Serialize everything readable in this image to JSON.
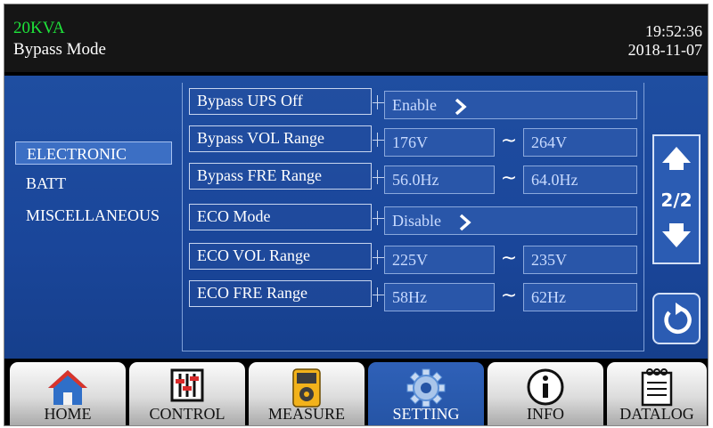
{
  "header": {
    "model": "20KVA",
    "mode": "Bypass Mode",
    "time": "19:52:36",
    "date": "2018-11-07"
  },
  "categories": [
    "ELECTRONIC",
    "BATT",
    "MISCELLANEOUS"
  ],
  "selected_category": "ELECTRONIC",
  "settings": {
    "bypass_ups_off": {
      "label": "Bypass UPS Off",
      "value": "Enable"
    },
    "bypass_vol_range": {
      "label": "Bypass VOL Range",
      "low": "176V",
      "high": "264V"
    },
    "bypass_fre_range": {
      "label": "Bypass FRE Range",
      "low": "56.0Hz",
      "high": "64.0Hz"
    },
    "eco_mode": {
      "label": "ECO Mode",
      "value": "Disable"
    },
    "eco_vol_range": {
      "label": "ECO VOL Range",
      "low": "225V",
      "high": "235V"
    },
    "eco_fre_range": {
      "label": "ECO FRE Range",
      "low": "58Hz",
      "high": "62Hz"
    },
    "range_separator": "~"
  },
  "pager": {
    "indicator": "2/2"
  },
  "tabs": {
    "home": "HOME",
    "control": "CONTROL",
    "measure": "MEASURE",
    "setting": "SETTING",
    "info": "INFO",
    "datalog": "DATALOG",
    "active": "SETTING"
  },
  "icons": [
    "home-icon",
    "control-sliders-icon",
    "multimeter-icon",
    "gear-icon",
    "info-icon",
    "datalog-icon",
    "arrow-up-icon",
    "arrow-down-icon",
    "back-icon",
    "chevron-right-icon"
  ],
  "colors": {
    "model_text": "#1ee33a",
    "panel_blue": "#1f4ea1",
    "active_tab": "#2f61b8"
  }
}
